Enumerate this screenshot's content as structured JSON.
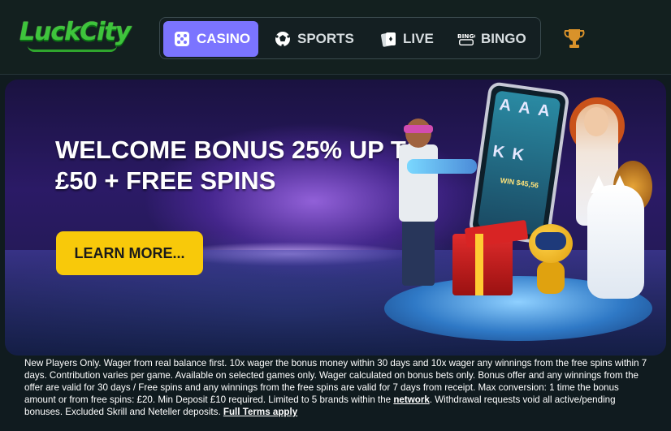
{
  "header": {
    "logo_text": "LuckCity",
    "nav": [
      {
        "label": "CASINO",
        "icon": "dice-icon",
        "active": true
      },
      {
        "label": "SPORTS",
        "icon": "soccer-ball-icon",
        "active": false
      },
      {
        "label": "LIVE",
        "icon": "cards-icon",
        "active": false
      },
      {
        "label": "BINGO",
        "icon": "bingo-icon",
        "active": false
      }
    ],
    "trophy_icon": "trophy-icon"
  },
  "banner": {
    "headline_line1": "WELCOME BONUS 25% UP TO",
    "headline_line2": "£50 + FREE SPINS",
    "cta_label": "LEARN MORE...",
    "slot_win": "WIN $45,56"
  },
  "terms": {
    "text_part1": "New Players Only. Wager from real balance first. 10x wager the bonus money within 30 days and 10x wager any winnings from the free spins within 7 days. Contribution varies per game. Available on selected games only. Wager calculated on bonus bets only. Bonus offer and any winnings from the offer are valid for 30 days / Free spins and any winnings from the free spins are valid for 7 days from receipt. Max conversion: 1 time the bonus amount or from free spins: £20. Min Deposit £10 required. Limited to 5 brands within the ",
    "network_link": "network",
    "text_part2": ". Withdrawal requests void all active/pending bonuses. Excluded Skrill and Neteller deposits. ",
    "full_terms_link": "Full Terms apply"
  },
  "colors": {
    "background": "#101b1f",
    "nav_active": "#7b74ff",
    "cta": "#f8c90a",
    "logo": "#3ec43c",
    "trophy": "#d9922a"
  }
}
